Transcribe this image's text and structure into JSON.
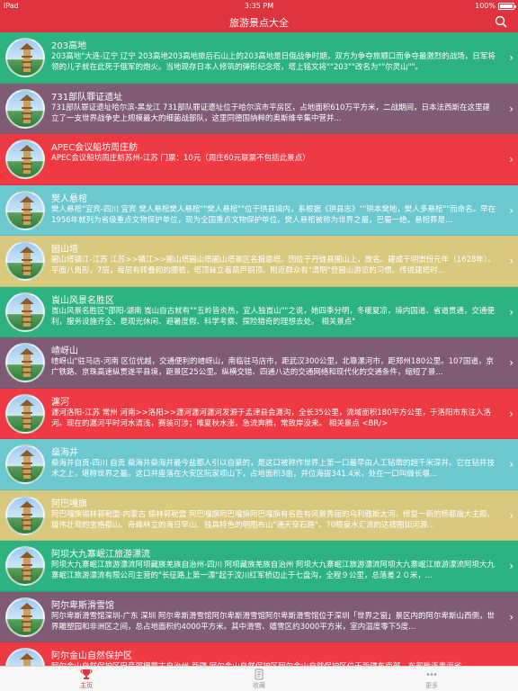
{
  "status": {
    "left": "iPad",
    "time": "3:35 PM",
    "battery": "100%",
    "battery_level": 1.0
  },
  "nav": {
    "title": "旅游景点大全",
    "search_icon": "search-icon"
  },
  "colors": {
    "accent": "#e1333d",
    "teal": "#6bc8cf",
    "green": "#2db37f",
    "purple": "#7f5b76",
    "yellow": "#d8c97e",
    "red": "#f03a43"
  },
  "items": [
    {
      "name": "203高地",
      "desc": "203高地\"大连-辽宁 辽宁 203高地203高地旅后石山上的203高地是日俄战争时期，双方为争夺旅顺口而争夺最激烈的战场，日军将领的儿子就在此死于俄军的炮火。当地现存日本人修筑的弹形纪念塔，塔上铭文将\"\"203\"\"改名为\"\"尔灵山\"\"。",
      "color": "#2db37f"
    },
    {
      "name": "731部队罪证遗址",
      "desc": "731部队罪证遗址哈尔滨-黑龙江 731部队罪证遗址位于哈尔滨市平房区，占地面积610万平方米，二战期间，日本法西斯在这里建立了一支世界战争史上规模最大的细菌战部队，这里同德国纳粹的奥斯维辛集中营并...",
      "color": "#7f5b76"
    },
    {
      "name": "APEC会议船坊周庄舫",
      "desc": "APEC会议船坊周庄舫苏州-江苏 门票：10元（周庄60元联票不包括此景点）",
      "color": "#f03a43"
    },
    {
      "name": "樊人悬棺",
      "desc": "樊人悬棺\"宜宾-四川 宜宾 樊人悬棺樊人悬棺\"\"樊人悬棺\"\"位于珙县境内，系根据《珙县志》\"\"珙本樊地，樊人多悬棺\"\"而命名。早在1956年就列为省级重点文物保护单位，现为全国重点文物保护单位。樊人悬棺被称为世界之最，巴蜀一绝。悬棺葬是...",
      "color": "#6bc8cf"
    },
    {
      "name": "圌山塔",
      "desc": "圌山塔镇江-江苏 江苏>>镇江>>圌山塔圌山塔圌山塔景区名报恩塔。因位于丹徒县圌山上，故名。建成于明崇份元年（1628年）。平面八角形，7层，每层有砖叠砌的腰檐，塔顶耸立着葫芦铜顶。附近群众有\"清明\"登圌山游览的习惯。传说建塔时...",
      "color": "#d8c97e"
    },
    {
      "name": "崀山风景名胜区",
      "desc": "崀山风景名胜区\"邵阳-湖南 崀山自古就有\"\"五岭皆炎热，宜人独崀山\"\"之说，她四季分明，冬暖夏凉，境内国道、省道贯通，交通便利，服务设施齐全，是观光休闲、避暑度假、科学考察、探险猎奇的理想去处。 相关景点\"",
      "color": "#2db37f"
    },
    {
      "name": "嵖岈山",
      "desc": "嵖岈山\"驻马店-河南 区位优越，交通便利的嵖岈山，南临驻马店市，距武汉300公里，北靠漯河市，距郑州180公里。107国道，京广铁路、京珠高速纵贯遂平县境，距景区25公里。纵横交错、四通八达的交通网络和现代化的交通条件，缩短了景...",
      "color": "#7f5b76"
    },
    {
      "name": "瀍河",
      "desc": "瀍河洛阳-江苏 常州 河南>>洛阳>>瀍河瀍河瀍河发源于孟津县会瀍沟，全长35公里，流域面积180平方公里，于洛阳市东注入洛河。现在的瀍河平时河水清浅，赛装可涉；唯夏秋水涨，急流奔腾，常致岸没来。 相关景点 <BR/>",
      "color": "#f03a43"
    },
    {
      "name": "燊海井",
      "desc": "燊海井自贡-四川 自贡 燊海井燊海井最今盐都人引以自豪的，是这口被称作世界上第一口最早由人工钻凿的超千米深井。它在钻井技术之上，堪称世界之最。这口井座落在大安区阮家坝山下，占地面积3亩，井位海拔341.4米，处在一口叫做长堰...",
      "color": "#6bc8cf"
    },
    {
      "name": "阿巴嘎旗",
      "desc": "阿巴嘎旗锡林郭勒盟-内蒙古 锡林郭勒盟 阿巴嘎旗阿巴嘎旗阿巴嘎旗有名胜有风景秀丽的乌利雅斯太河，修复一新的杨都庙大主殿、雄伟壮观的宝格都山、奇峰林立的海日罕山、独具特色的明图布山\"通天穿石路\"、70眼泉水汇流的达楞图如河源...",
      "color": "#d8c97e"
    },
    {
      "name": "阿坝大九寨岷江旅游漂流",
      "desc": "阿坝大九寨岷江旅游漂流阿坝藏族羌族自治州-四川 阿坝藏族羌族自治州 阿坝大九寨岷江旅游漂流阿坝大九寨岷江旅游漂流阿坝大九寨岷江旅游漂流有限公司主营的\"长征路上第一漂\"起于汶川红军桥边止于七盘沟，全程９公里，总落差２０米，...",
      "color": "#2db37f"
    },
    {
      "name": "阿尔卑斯滑雪馆",
      "desc": "阿尔卑斯滑雪馆深圳-广东 深圳 阿尔卑斯滑雪馆阿尔卑斯滑雪馆阿尔卑斯滑雪馆位于深圳「世界之窗」景区内的阿尔卑斯山西侧，世界雕塑园和非洲区之间，总占地面积约4000平方米。其中滑雪、嬉雪区约3000平方米，室内温度零下5度...",
      "color": "#7f5b76"
    },
    {
      "name": "阿尔金山自然保护区",
      "desc": "阿尔金山自然保护区巴音郭楞蒙古自治州-新疆 阿尔金山自然保护区阿尔金山自然保护区位于新疆东南部，东部毗连青海省",
      "color": "#f03a43"
    }
  ],
  "tabs": [
    {
      "label": "主页",
      "icon": "trophy-icon",
      "active": true
    },
    {
      "label": "收藏",
      "icon": "bookmark-icon",
      "active": false
    },
    {
      "label": "更多",
      "icon": "more-icon",
      "active": false
    }
  ]
}
